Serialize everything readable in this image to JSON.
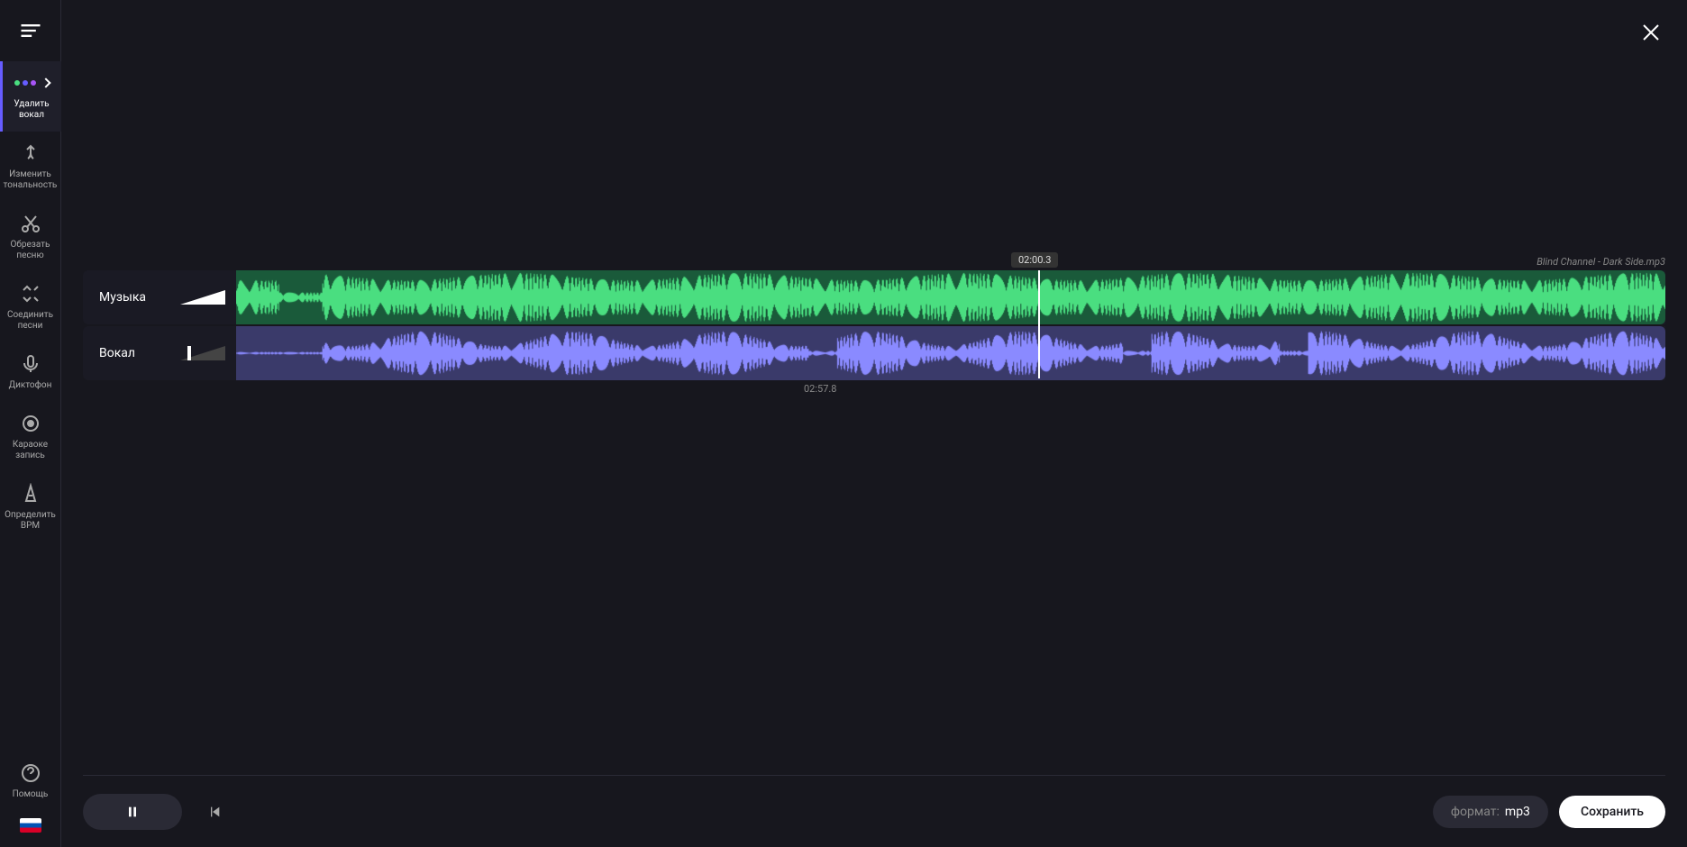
{
  "sidebar": {
    "items": [
      {
        "label": "Удалить вокал",
        "icon": "vocal-remove"
      },
      {
        "label": "Изменить тональность",
        "icon": "pitch"
      },
      {
        "label": "Обрезать песню",
        "icon": "cut"
      },
      {
        "label": "Соединить песни",
        "icon": "join"
      },
      {
        "label": "Диктофон",
        "icon": "mic"
      },
      {
        "label": "Караоке запись",
        "icon": "karaoke"
      },
      {
        "label": "Определить BPM",
        "icon": "bpm"
      }
    ],
    "help": "Помощь"
  },
  "playhead_time": "02:00.3",
  "filename": "Blind Channel - Dark Side.mp3",
  "tracks": {
    "music": {
      "label": "Музыка",
      "volume_percent": 100
    },
    "vocal": {
      "label": "Вокал",
      "volume_percent": 15
    }
  },
  "duration": "02:57.8",
  "format": {
    "label": "формат:",
    "value": "mp3"
  },
  "save": "Сохранить"
}
